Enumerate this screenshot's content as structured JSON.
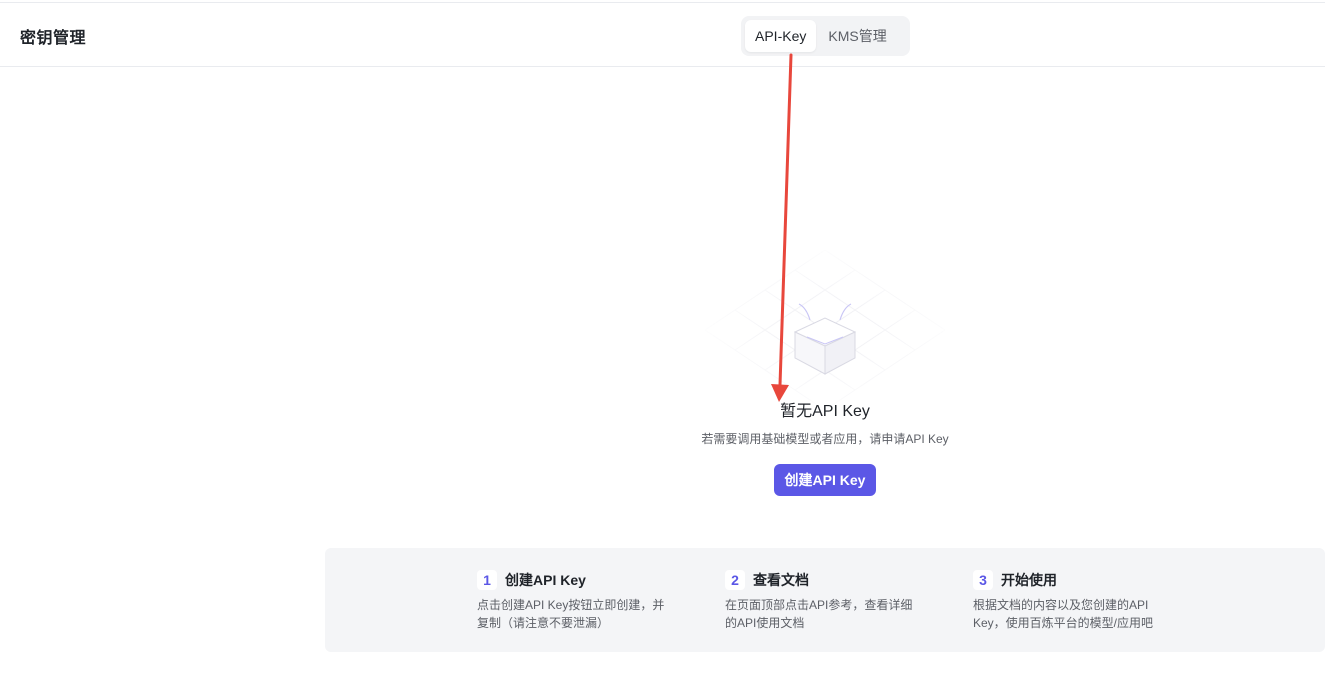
{
  "header": {
    "title": "密钥管理",
    "tabs": [
      {
        "label": "API-Key",
        "active": true
      },
      {
        "label": "KMS管理",
        "active": false
      }
    ]
  },
  "empty_state": {
    "illustration_icon": "empty-box-icon",
    "title": "暂无API Key",
    "description": "若需要调用基础模型或者应用，请申请API Key",
    "button_label": "创建API Key"
  },
  "steps": [
    {
      "number": "1",
      "title": "创建API Key",
      "line1": "点击创建API Key按钮立即创建，并",
      "line2": "复制（请注意不要泄漏）"
    },
    {
      "number": "2",
      "title": "查看文档",
      "line1": "在页面顶部点击API参考，查看详细",
      "line2": "的API使用文档"
    },
    {
      "number": "3",
      "title": "开始使用",
      "line1": "根据文档的内容以及您创建的API",
      "line2": "Key，使用百炼平台的模型/应用吧"
    }
  ],
  "annotation": {
    "arrow_color": "#e8473c"
  },
  "colors": {
    "accent": "#5b57e6",
    "panel_bg": "#f4f5f7"
  }
}
